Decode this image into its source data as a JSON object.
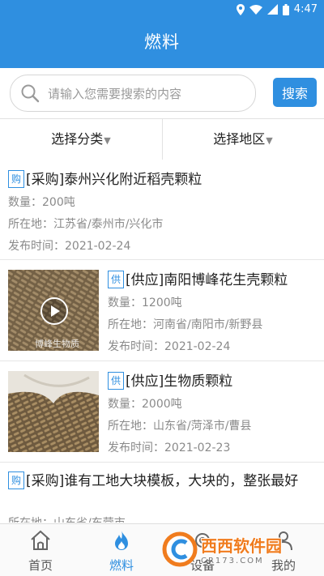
{
  "status_bar": {
    "time": "4:47"
  },
  "header": {
    "title": "燃料"
  },
  "search": {
    "placeholder": "请输入您需要搜索的内容",
    "button_label": "搜索"
  },
  "filters": {
    "category_label": "选择分类",
    "region_label": "选择地区"
  },
  "listings": [
    {
      "tag": "购",
      "title": "[采购]泰州兴化附近稻壳颗粒",
      "quantity": "数量：200吨",
      "location": "所在地：江苏省/泰州市/兴化市",
      "date": "发布时间：2021-02-24"
    },
    {
      "tag": "供",
      "title": "[供应]南阳博峰花生壳颗粒",
      "quantity": "数量：1200吨",
      "location": "所在地：河南省/南阳市/新野县",
      "date": "发布时间：2021-02-24",
      "image_text": "博峰生物质"
    },
    {
      "tag": "供",
      "title": "[供应]生物质颗粒",
      "quantity": "数量：2000吨",
      "location": "所在地：山东省/菏泽市/曹县",
      "date": "发布时间：2021-02-23"
    },
    {
      "tag": "购",
      "title": "[采购]谁有工地大块模板，大块的，整张最好",
      "location": "所在地：山东省/东营市"
    }
  ],
  "tabs": [
    {
      "label": "首页",
      "icon": "home-icon"
    },
    {
      "label": "燃料",
      "icon": "flame-icon",
      "active": true
    },
    {
      "label": "设备",
      "icon": "equipment-icon"
    },
    {
      "label": "我的",
      "icon": "user-icon"
    }
  ],
  "watermark": {
    "text": "西西软件园",
    "subtext": "CR173.COM"
  },
  "colors": {
    "primary": "#2f8fe0",
    "meta_text": "#8a8a8a",
    "watermark_orange": "#f07c1e"
  }
}
